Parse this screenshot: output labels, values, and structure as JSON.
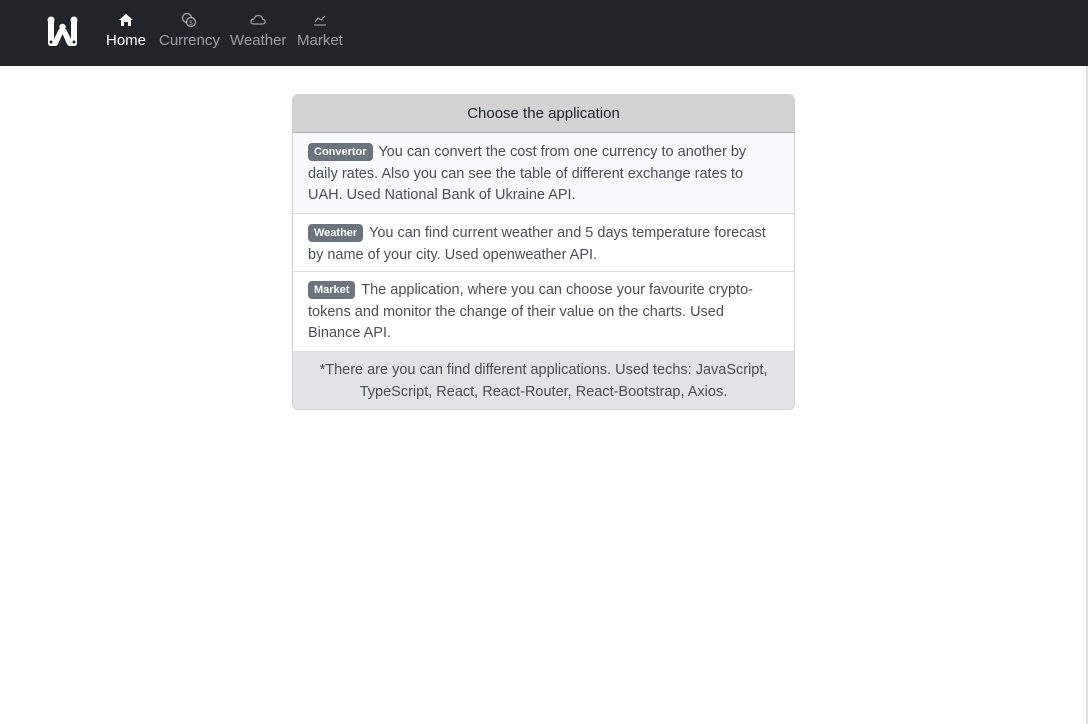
{
  "navbar": {
    "brand_icon": "w-logo-icon",
    "links": [
      {
        "label": "Home",
        "icon": "house-icon",
        "active": true
      },
      {
        "label": "Currency",
        "icon": "coins-icon",
        "active": false
      },
      {
        "label": "Weather",
        "icon": "cloud-icon",
        "active": false
      },
      {
        "label": "Market",
        "icon": "chart-line-icon",
        "active": false
      }
    ]
  },
  "card": {
    "header": "Choose the application",
    "items": [
      {
        "badge": "Convertor",
        "text": "You can convert the cost from one currency to another by daily rates. Also you can see the table of different exchange rates to UAH. Used National Bank of Ukraine API."
      },
      {
        "badge": "Weather",
        "text": "You can find current weather and 5 days temperature forecast by name of your city. Used openweather API."
      },
      {
        "badge": "Market",
        "text": "The application, where you can choose your favourite crypto-tokens and monitor the change of their value on the charts. Used Binance API."
      }
    ],
    "footer": "*There are you can find different applications. Used techs: JavaScript, TypeScript, React, React-Router, React-Bootstrap, Axios."
  },
  "colors": {
    "navbar_bg": "#212529",
    "card_header_bg": "#d3d3d3",
    "card_footer_bg": "#e2e3e5",
    "badge_bg": "#6c757d"
  }
}
